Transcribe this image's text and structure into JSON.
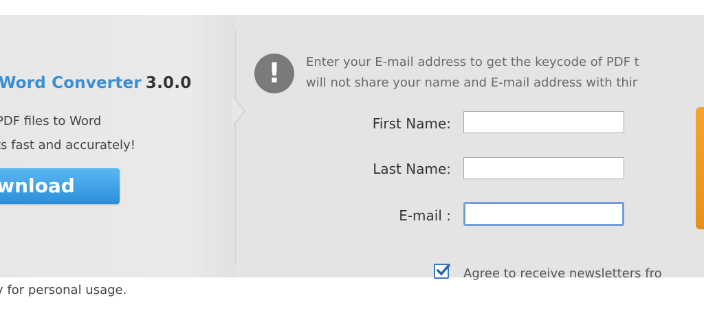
{
  "product": {
    "name": "Word Converter",
    "version": "3.0.0",
    "desc_line1": "PDF files to Word",
    "desc_line2": "ts fast and accurately!",
    "download_label": "ownload"
  },
  "notice": {
    "line1": "Enter your E-mail address to get the keycode of PDF t",
    "line2": "will not share your name and E-mail address with thir"
  },
  "form": {
    "first_name_label": "First Name:",
    "first_name_value": "",
    "last_name_label": "Last Name:",
    "last_name_value": "",
    "email_label": "E-mail :",
    "email_value": "",
    "newsletter_checked": true,
    "newsletter_label": "Agree to receive newsletters fro"
  },
  "footer": {
    "note": "y for personal usage."
  },
  "colors": {
    "brand_blue": "#3a8ed2",
    "button_blue": "#2a8fdb",
    "accent_orange": "#f5a430",
    "focus_border": "#6f9fd8"
  },
  "icons": {
    "alert": "exclamation-circle-icon",
    "check": "checkmark-icon"
  }
}
